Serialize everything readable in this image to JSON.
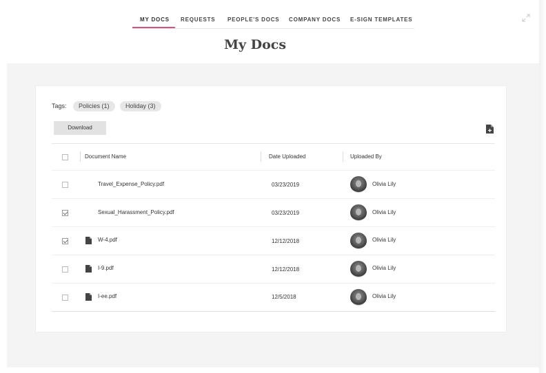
{
  "nav": {
    "tabs": [
      {
        "label": "MY DOCS",
        "active": true
      },
      {
        "label": "REQUESTS",
        "active": false
      },
      {
        "label": "PEOPLE'S DOCS",
        "active": false
      },
      {
        "label": "COMPANY DOCS",
        "active": false
      },
      {
        "label": "E-SIGN TEMPLATES",
        "active": false
      }
    ],
    "accent_color": "#d9507a"
  },
  "page": {
    "title": "My Docs"
  },
  "tags": {
    "label": "Tags:",
    "items": [
      {
        "label": "Policies (1)"
      },
      {
        "label": "Holiday (3)"
      }
    ]
  },
  "toolbar": {
    "download_label": "Download",
    "upload_icon": "add-file-icon",
    "expand_icon": "expand-icon"
  },
  "table": {
    "columns": [
      "Document Name",
      "Date Uploaded",
      "Uploaded By"
    ],
    "rows": [
      {
        "name": "Travel_Expense_Policy.pdf",
        "date": "03/23/2019",
        "uploader": "Olivia Lily",
        "checked": false,
        "file_icon": false
      },
      {
        "name": "Sexual_Harassment_Policy.pdf",
        "date": "03/23/2019",
        "uploader": "Olivia Lily",
        "checked": true,
        "file_icon": false
      },
      {
        "name": "W-4.pdf",
        "date": "12/12/2018",
        "uploader": "Olivia Lily",
        "checked": true,
        "file_icon": true
      },
      {
        "name": "I-9.pdf",
        "date": "12/12/2018",
        "uploader": "Olivia Lily",
        "checked": false,
        "file_icon": true
      },
      {
        "name": "I-ee.pdf",
        "date": "12/5/2018",
        "uploader": "Olivia Lily",
        "checked": false,
        "file_icon": true
      }
    ]
  }
}
